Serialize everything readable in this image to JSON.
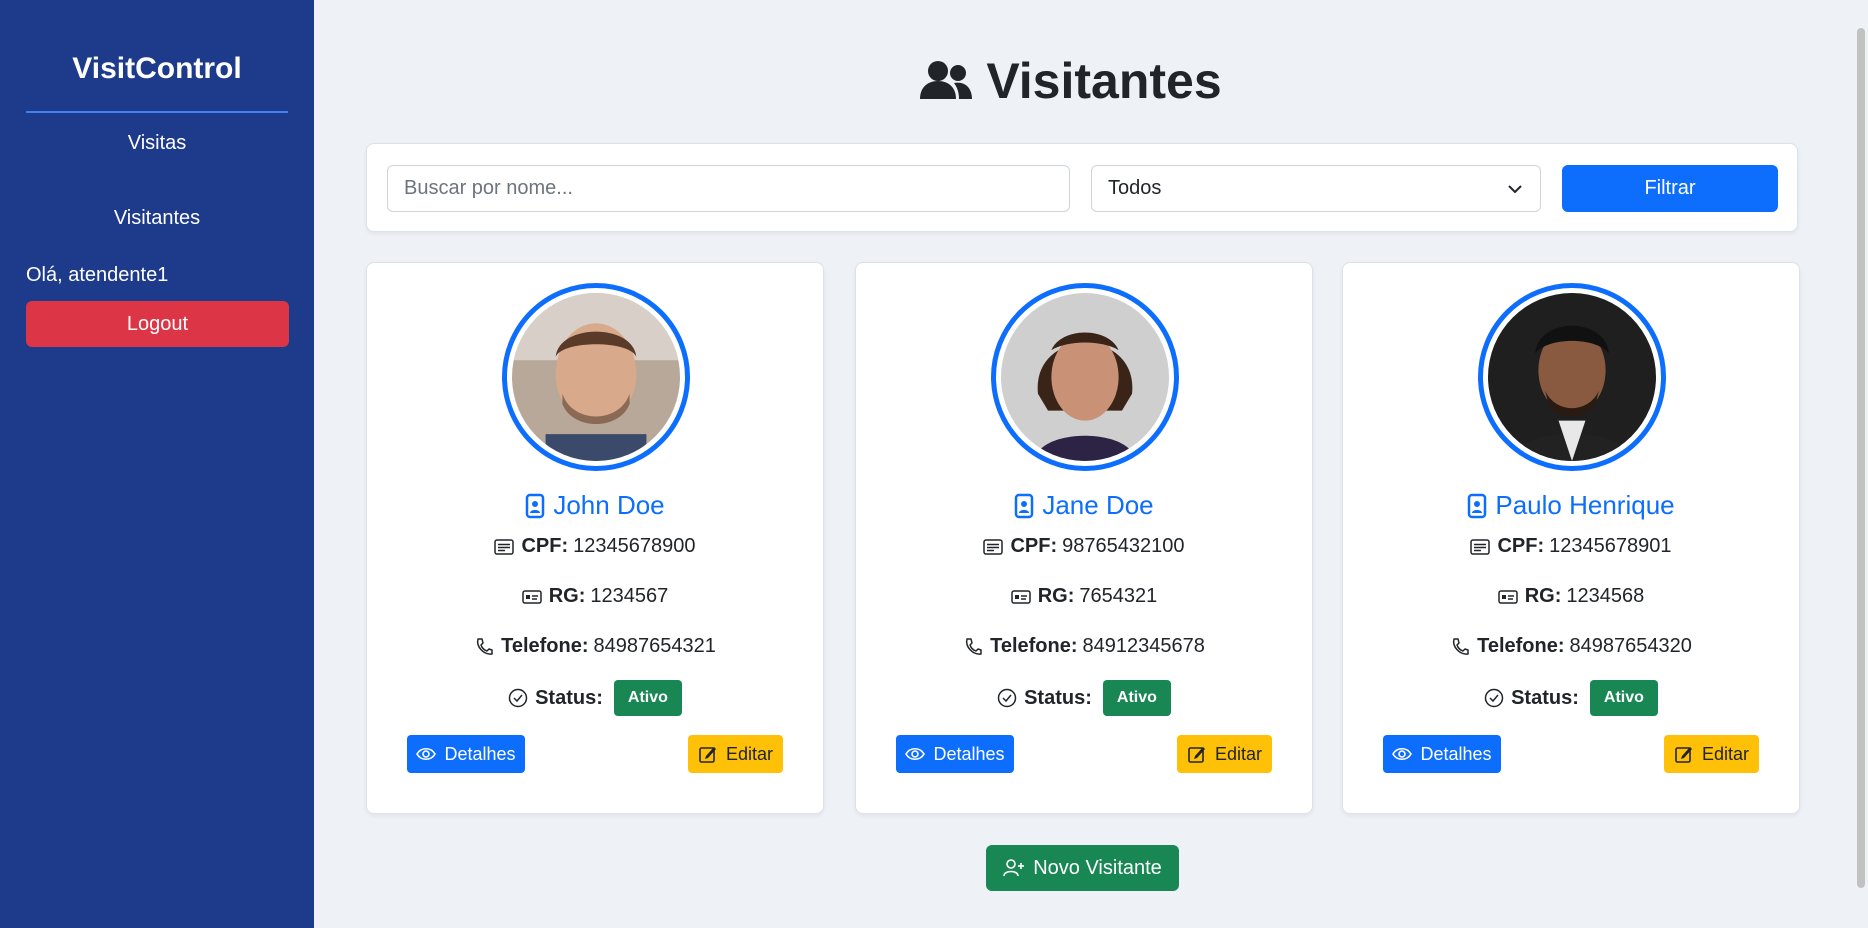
{
  "sidebar": {
    "brand": "VisitControl",
    "nav": [
      "Visitas",
      "Visitantes"
    ],
    "greeting": "Olá, atendente1",
    "logout_label": "Logout"
  },
  "page": {
    "title": "Visitantes",
    "title_icon": "users-icon"
  },
  "filter": {
    "search_placeholder": "Buscar por nome...",
    "search_value": "",
    "select_value": "Todos",
    "filter_label": "Filtrar"
  },
  "labels": {
    "cpf": "CPF:",
    "rg": "RG:",
    "phone": "Telefone:",
    "status": "Status:",
    "details": "Detalhes",
    "edit": "Editar"
  },
  "visitors": [
    {
      "name": "John Doe",
      "cpf": "12345678900",
      "rg": "1234567",
      "phone": "84987654321",
      "status": "Ativo"
    },
    {
      "name": "Jane Doe",
      "cpf": "98765432100",
      "rg": "7654321",
      "phone": "84912345678",
      "status": "Ativo"
    },
    {
      "name": "Paulo Henrique",
      "cpf": "12345678901",
      "rg": "1234568",
      "phone": "84987654320",
      "status": "Ativo"
    }
  ],
  "new_visitor_label": "Novo Visitante",
  "colors": {
    "sidebar": "#1e3a8a",
    "primary": "#0d6efd",
    "danger": "#dc3545",
    "success": "#198754",
    "warning": "#ffc107"
  }
}
